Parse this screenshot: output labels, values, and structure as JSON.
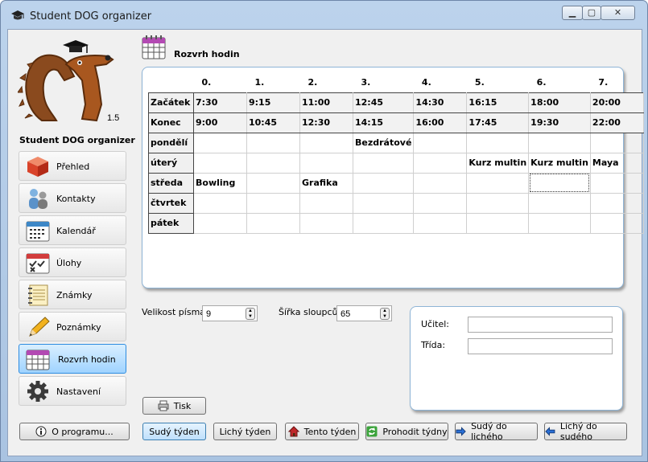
{
  "window": {
    "title": "Student DOG organizer",
    "min": "▁",
    "max": "▢",
    "close": "✕"
  },
  "logo": {
    "version": "1.5",
    "app_name": "Student DOG organizer"
  },
  "nav": [
    {
      "label": "Přehled",
      "icon": "box-icon"
    },
    {
      "label": "Kontakty",
      "icon": "people-icon"
    },
    {
      "label": "Kalendář",
      "icon": "calendar-icon"
    },
    {
      "label": "Úlohy",
      "icon": "tasks-icon"
    },
    {
      "label": "Známky",
      "icon": "notepad-icon"
    },
    {
      "label": "Poznámky",
      "icon": "pencil-icon"
    },
    {
      "label": "Rozvrh hodin",
      "icon": "schedule-icon",
      "active": true
    },
    {
      "label": "Nastavení",
      "icon": "gear-icon"
    }
  ],
  "about_button": "O programu...",
  "header": {
    "title": "Rozvrh hodin"
  },
  "schedule": {
    "columns": [
      "0.",
      "1.",
      "2.",
      "3.",
      "4.",
      "5.",
      "6.",
      "7."
    ],
    "rows": [
      {
        "label": "Začátek",
        "cells": [
          "7:30",
          "9:15",
          "11:00",
          "12:45",
          "14:30",
          "16:15",
          "18:00",
          "20:00"
        ]
      },
      {
        "label": "Konec",
        "cells": [
          "9:00",
          "10:45",
          "12:30",
          "14:15",
          "16:00",
          "17:45",
          "19:30",
          "22:00"
        ]
      },
      {
        "label": "pondělí",
        "cells": [
          "",
          "",
          "",
          "Bezdrátové",
          "",
          "",
          "",
          ""
        ]
      },
      {
        "label": "úterý",
        "cells": [
          "",
          "",
          "",
          "",
          "",
          "Kurz multin",
          "Kurz multin",
          "Maya"
        ]
      },
      {
        "label": "středa",
        "cells": [
          "Bowling",
          "",
          "Grafika",
          "",
          "",
          "",
          "",
          ""
        ]
      },
      {
        "label": "čtvrtek",
        "cells": [
          "",
          "",
          "",
          "",
          "",
          "",
          "",
          ""
        ]
      },
      {
        "label": "pátek",
        "cells": [
          "",
          "",
          "",
          "",
          "",
          "",
          "",
          ""
        ]
      }
    ]
  },
  "settings": {
    "font_size_label": "Velikost písma:",
    "font_size_value": "9",
    "col_width_label": "Šířka sloupců:",
    "col_width_value": "65"
  },
  "details": {
    "teacher_label": "Učitel:",
    "class_label": "Třída:",
    "teacher_value": "",
    "class_value": ""
  },
  "buttons": {
    "print": "Tisk",
    "even_week": "Sudý týden",
    "odd_week": "Lichý týden",
    "this_week": "Tento týden",
    "swap_weeks": "Prohodit týdny",
    "even_to_odd": "Sudý do lichého",
    "odd_to_even": "Lichý do sudého"
  }
}
